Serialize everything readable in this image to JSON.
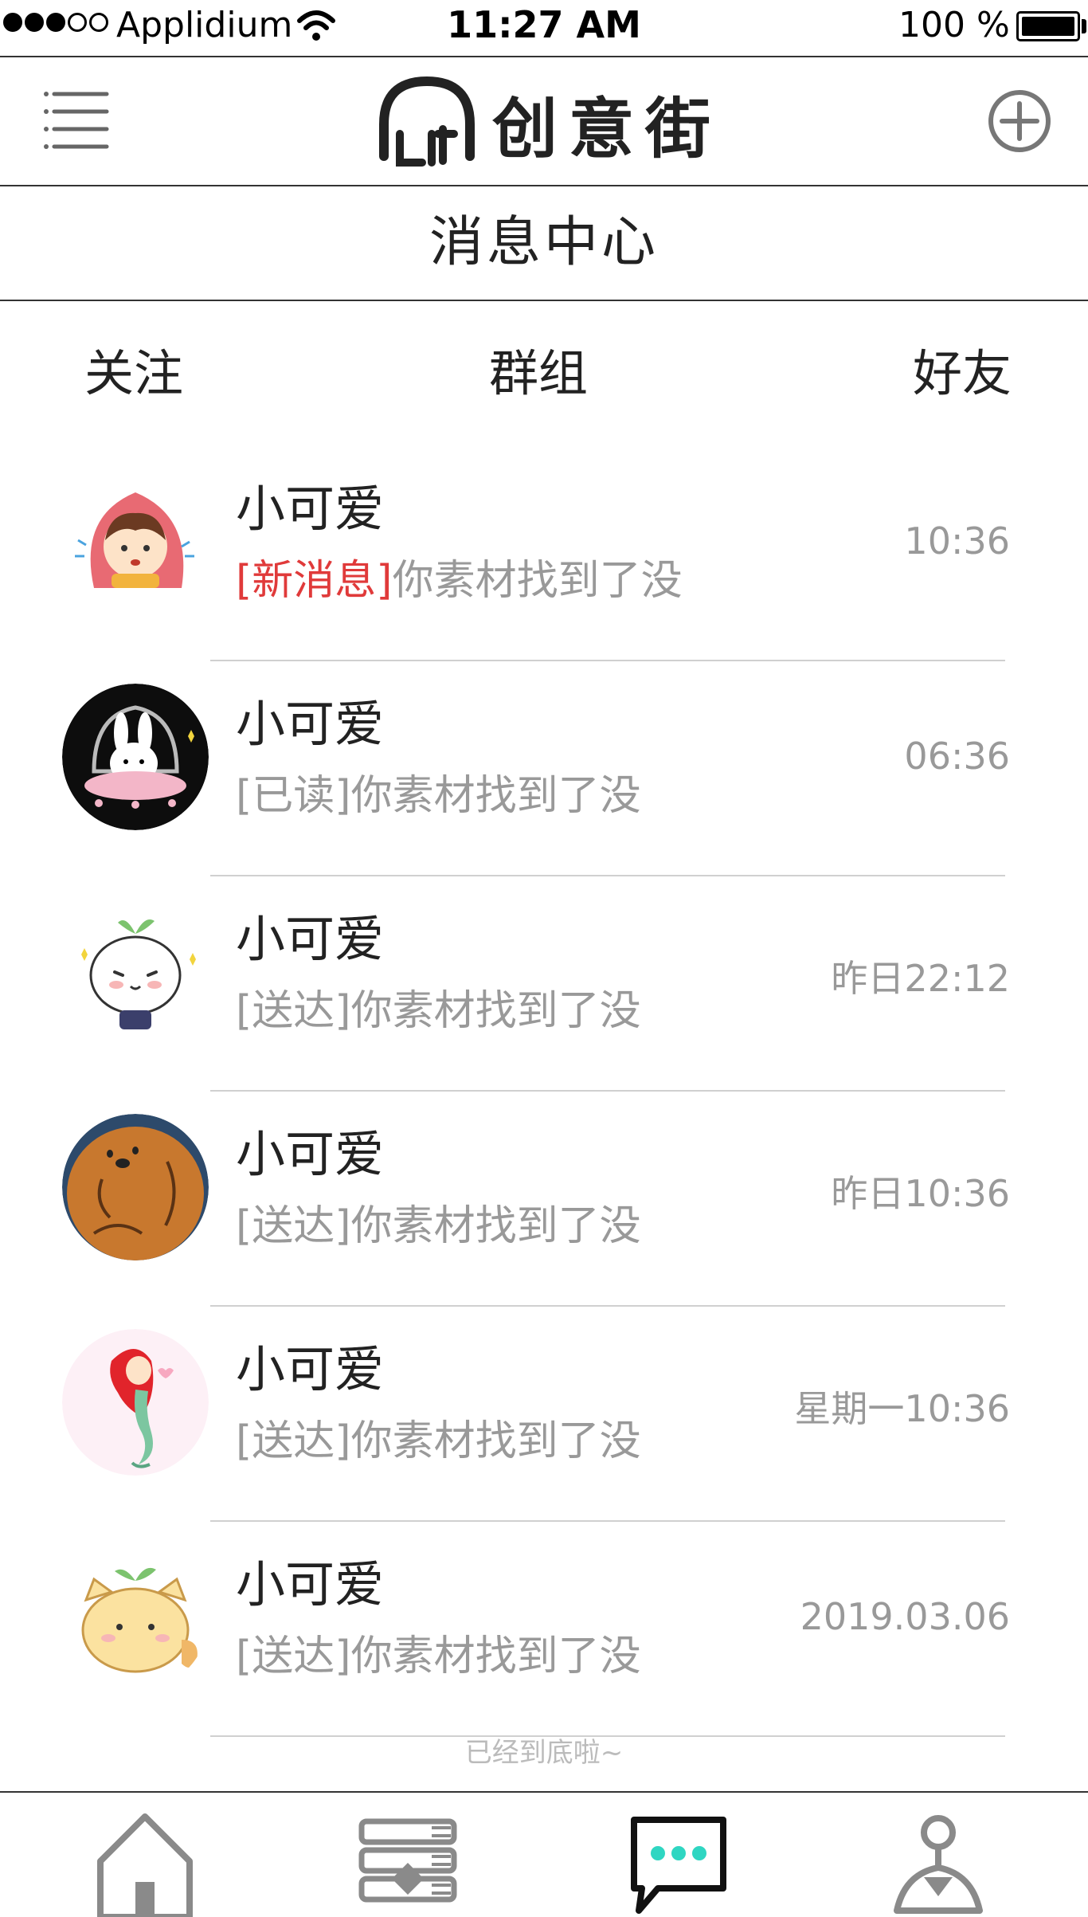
{
  "status_bar": {
    "carrier": "Applidium",
    "time": "11:27 AM",
    "battery": "100 %",
    "signal_bars_filled": 3,
    "signal_bars_total": 5
  },
  "header": {
    "logo_text": "创意街",
    "menu_icon": "hamburger-icon",
    "add_icon": "plus-circle-icon"
  },
  "page_title": "消息中心",
  "tabs": [
    {
      "label": "关注"
    },
    {
      "label": "群组"
    },
    {
      "label": "好友"
    }
  ],
  "messages": [
    {
      "name": "小可爱",
      "status": "[新消息]",
      "text": "你素材找到了没",
      "time": "10:36",
      "is_new": true,
      "avatar_icon": "girl-hood-avatar"
    },
    {
      "name": "小可爱",
      "status": "[已读]",
      "text": "你素材找到了没",
      "time": "06:36",
      "is_new": false,
      "avatar_icon": "bunny-avatar"
    },
    {
      "name": "小可爱",
      "status": "[送达]",
      "text": "你素材找到了没",
      "time": "昨日22:12",
      "is_new": false,
      "avatar_icon": "sprout-bun-avatar"
    },
    {
      "name": "小可爱",
      "status": "[送达]",
      "text": "你素材找到了没",
      "time": "昨日10:36",
      "is_new": false,
      "avatar_icon": "bear-avatar"
    },
    {
      "name": "小可爱",
      "status": "[送达]",
      "text": "你素材找到了没",
      "time": "星期一10:36",
      "is_new": false,
      "avatar_icon": "mermaid-avatar"
    },
    {
      "name": "小可爱",
      "status": "[送达]",
      "text": "你素材找到了没",
      "time": "2019.03.06",
      "is_new": false,
      "avatar_icon": "cat-sprout-avatar"
    }
  ],
  "end_note": "已经到底啦~",
  "bottom_nav": [
    {
      "icon": "home-icon",
      "active": false
    },
    {
      "icon": "books-icon",
      "active": false
    },
    {
      "icon": "chat-bubble-icon",
      "active": true
    },
    {
      "icon": "profile-icon",
      "active": false
    }
  ],
  "colors": {
    "new_status": "#e03a3a",
    "muted": "#999999",
    "active_accent": "#2fd6c2"
  }
}
